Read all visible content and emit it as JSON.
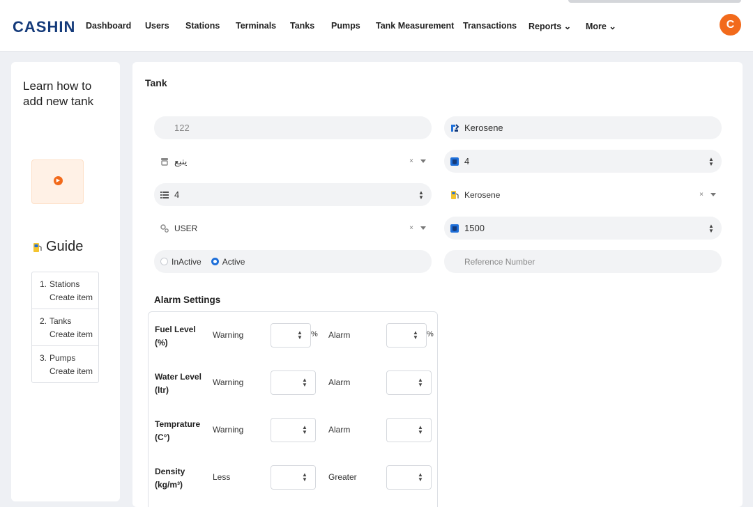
{
  "app": {
    "logo": "CASHIN",
    "avatar_initial": "C"
  },
  "nav": {
    "dashboard": "Dashboard",
    "users": "Users",
    "stations": "Stations",
    "terminals": "Terminals",
    "tanks": "Tanks",
    "pumps": "Pumps",
    "tank_measurement": "Tank Measurement",
    "transactions": "Transactions",
    "reports": "Reports",
    "more": "More"
  },
  "guide": {
    "intro": "Learn how to add new tank",
    "heading": "Guide",
    "steps": [
      {
        "num": "1.",
        "text": "Stations Create item"
      },
      {
        "num": "2.",
        "text": "Tanks Create item"
      },
      {
        "num": "3.",
        "text": "Pumps Create item"
      }
    ]
  },
  "form": {
    "title": "Tank",
    "tank_code": "122",
    "tank_name": "Kerosene",
    "station": "ينبع",
    "field_number_right": "4",
    "field_number_left": "4",
    "fuel_type": "Kerosene",
    "user": "USER",
    "capacity": "1500",
    "status_inactive": "InActive",
    "status_active": "Active",
    "reference_placeholder": "Reference Number",
    "selected_status": "Active"
  },
  "alarm": {
    "title": "Alarm Settings",
    "rows": [
      {
        "label": "Fuel Level (%)",
        "low": "Warning",
        "high": "Alarm",
        "unit": "%"
      },
      {
        "label": "Water Level (ltr)",
        "low": "Warning",
        "high": "Alarm",
        "unit": ""
      },
      {
        "label": "Temprature (C°)",
        "low": "Warning",
        "high": "Alarm",
        "unit": ""
      },
      {
        "label": "Density (kg/m³)",
        "low": "Less",
        "high": "Greater",
        "unit": ""
      }
    ]
  },
  "colors": {
    "brand": "#143a7a",
    "accent": "#f26a1b",
    "active_radio": "#1e6fd9"
  }
}
